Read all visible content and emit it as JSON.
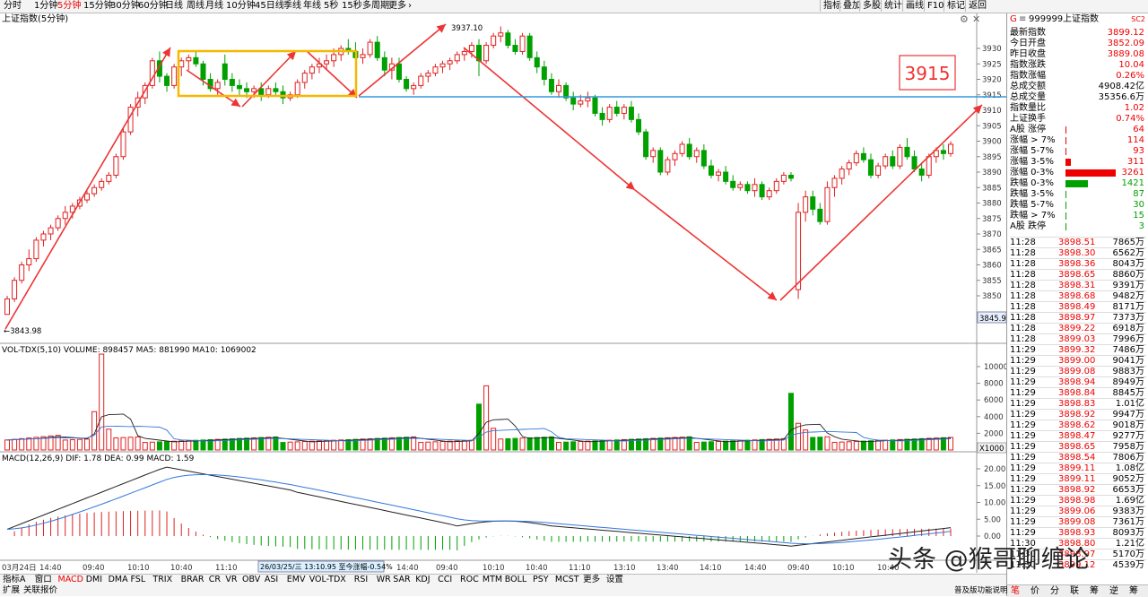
{
  "toolbar": {
    "timeframes": [
      "分时",
      "1分钟",
      "5分钟",
      "15分钟",
      "30分钟",
      "60分钟",
      "日线",
      "周线",
      "月线",
      "10分钟",
      "45日线",
      "季线",
      "年线",
      "5秒",
      "15秒",
      "多周期",
      "更多"
    ],
    "active_timeframe_index": 2,
    "right_buttons": [
      "指标",
      "叠加",
      "多股",
      "统计",
      "画线",
      "F10",
      "标记",
      "返回"
    ]
  },
  "chart_title": "上证指数(5分钟)",
  "main_chart": {
    "price_ticks": [
      "3930",
      "3925",
      "3920",
      "3915",
      "3910",
      "3905",
      "3900",
      "3895",
      "3890",
      "3885",
      "3880",
      "3875",
      "3870",
      "3865",
      "3860",
      "3855",
      "3850"
    ],
    "current_price_tag": "3845.9",
    "high_label": "3937.10",
    "low_label": "3843.98",
    "annotation_box": "3915"
  },
  "volume_panel": {
    "header": "VOL-TDX(5,10) VOLUME: 898457 MA5: 881990 MA10: 1069002",
    "ticks": [
      "10000",
      "8000",
      "6000",
      "4000",
      "2000"
    ],
    "unit": "X1000"
  },
  "macd_panel": {
    "header": "MACD(12,26,9) DIF: 1.78 DEA: 0.99 MACD: 1.59",
    "ticks": [
      "20.00",
      "15.00",
      "10.00",
      "5.00",
      "0.00"
    ]
  },
  "time_axis": [
    "03月24日",
    "14:40",
    "09:40",
    "10:10",
    "10:40",
    "11:10",
    "13:10",
    "13:40",
    "14:10",
    "14:40",
    "09:40",
    "10:10",
    "10:40",
    "11:10",
    "13:10",
    "13:40",
    "14:10",
    "14:40",
    "09:40",
    "10:10",
    "10:40"
  ],
  "tooltip": "26/03/25/三 13:10.95 至今涨幅-0.54%",
  "indicator_tabs": [
    "指标A",
    "窗口",
    "MACD",
    "DMI",
    "DMA",
    "FSL",
    "TRIX",
    "BRAR",
    "CR",
    "VR",
    "OBV",
    "ASI",
    "EMV",
    "VOL-TDX",
    "RSI",
    "WR",
    "SAR",
    "KDJ",
    "CCI",
    "ROC",
    "MTM",
    "BOLL",
    "PSY",
    "MCST",
    "更多",
    "设置"
  ],
  "active_tab": "MACD",
  "bottom_row": [
    "扩展",
    "关联报价"
  ],
  "right_panel": {
    "header_code": "999999",
    "header_name": "上证指数",
    "header_tag": "SC2",
    "stats": [
      {
        "label": "最新指数",
        "value": "3899.12"
      },
      {
        "label": "今日开盘",
        "value": "3852.09"
      },
      {
        "label": "昨日收盘",
        "value": "3889.08"
      },
      {
        "label": "指数涨跌",
        "value": "10.04"
      },
      {
        "label": "指数涨幅",
        "value": "0.26%"
      },
      {
        "label": "总成交额",
        "value": "4908.42亿"
      },
      {
        "label": "总成交量",
        "value": "35356.6万"
      },
      {
        "label": "指数量比",
        "value": "1.02"
      },
      {
        "label": "上证换手",
        "value": "0.74%"
      }
    ],
    "breadth": [
      {
        "label": "A股 涨停",
        "value": "64",
        "color": "#e00",
        "frac": 0.01
      },
      {
        "label": "涨幅 > 7%",
        "value": "114",
        "color": "#e00",
        "frac": 0.02
      },
      {
        "label": "涨幅 5-7%",
        "value": "93",
        "color": "#e00",
        "frac": 0.015
      },
      {
        "label": "涨幅 3-5%",
        "value": "311",
        "color": "#e00",
        "frac": 0.1
      },
      {
        "label": "涨幅 0-3%",
        "value": "3261",
        "color": "#e00",
        "frac": 1.0
      },
      {
        "label": "跌幅 0-3%",
        "value": "1421",
        "color": "#00a000",
        "frac": 0.44
      },
      {
        "label": "跌幅 3-5%",
        "value": "87",
        "color": "#00a000",
        "frac": 0.02
      },
      {
        "label": "跌幅 5-7%",
        "value": "30",
        "color": "#00a000",
        "frac": 0.01
      },
      {
        "label": "跌幅 > 7%",
        "value": "15",
        "color": "#00a000",
        "frac": 0.01
      },
      {
        "label": "A股 跌停",
        "value": "3",
        "color": "#00a000",
        "frac": 0.005
      }
    ],
    "ticks": [
      {
        "time": "11:28",
        "price": "3898.51",
        "vol": "7865万"
      },
      {
        "time": "11:28",
        "price": "3898.30",
        "vol": "6562万"
      },
      {
        "time": "11:28",
        "price": "3898.36",
        "vol": "8043万"
      },
      {
        "time": "11:28",
        "price": "3898.65",
        "vol": "8860万"
      },
      {
        "time": "11:28",
        "price": "3898.31",
        "vol": "9391万"
      },
      {
        "time": "11:28",
        "price": "3898.68",
        "vol": "9482万"
      },
      {
        "time": "11:28",
        "price": "3898.49",
        "vol": "8171万"
      },
      {
        "time": "11:28",
        "price": "3898.97",
        "vol": "7373万"
      },
      {
        "time": "11:28",
        "price": "3899.22",
        "vol": "6918万"
      },
      {
        "time": "11:28",
        "price": "3899.03",
        "vol": "7996万"
      },
      {
        "time": "11:29",
        "price": "3899.32",
        "vol": "7486万"
      },
      {
        "time": "11:29",
        "price": "3899.00",
        "vol": "9041万"
      },
      {
        "time": "11:29",
        "price": "3899.08",
        "vol": "9883万"
      },
      {
        "time": "11:29",
        "price": "3898.94",
        "vol": "8949万"
      },
      {
        "time": "11:29",
        "price": "3898.84",
        "vol": "8845万"
      },
      {
        "time": "11:29",
        "price": "3898.83",
        "vol": "1.01亿"
      },
      {
        "time": "11:29",
        "price": "3898.92",
        "vol": "9947万"
      },
      {
        "time": "11:29",
        "price": "3898.62",
        "vol": "9018万"
      },
      {
        "time": "11:29",
        "price": "3898.47",
        "vol": "9277万"
      },
      {
        "time": "11:29",
        "price": "3898.65",
        "vol": "7958万"
      },
      {
        "time": "11:29",
        "price": "3898.54",
        "vol": "7806万"
      },
      {
        "time": "11:29",
        "price": "3899.11",
        "vol": "1.08亿"
      },
      {
        "time": "11:29",
        "price": "3899.11",
        "vol": "9052万"
      },
      {
        "time": "11:29",
        "price": "3898.92",
        "vol": "6653万"
      },
      {
        "time": "11:29",
        "price": "3898.98",
        "vol": "1.69亿"
      },
      {
        "time": "11:29",
        "price": "3899.06",
        "vol": "9383万"
      },
      {
        "time": "11:29",
        "price": "3899.08",
        "vol": "7361万"
      },
      {
        "time": "11:29",
        "price": "3898.93",
        "vol": "8093万"
      },
      {
        "time": "11:30",
        "price": "3898.80",
        "vol": "1.21亿"
      },
      {
        "time": "11:30",
        "price": "3898.97",
        "vol": "5170万"
      },
      {
        "time": "11:30",
        "price": "3899.12",
        "vol": "4539万"
      }
    ],
    "bottom_tabs": [
      "笔",
      "价",
      "分",
      "联",
      "筹",
      "逆",
      "筹"
    ]
  },
  "watermark": "头条 @猴哥聊缠论",
  "footer_hint": "普及版功能说明"
}
